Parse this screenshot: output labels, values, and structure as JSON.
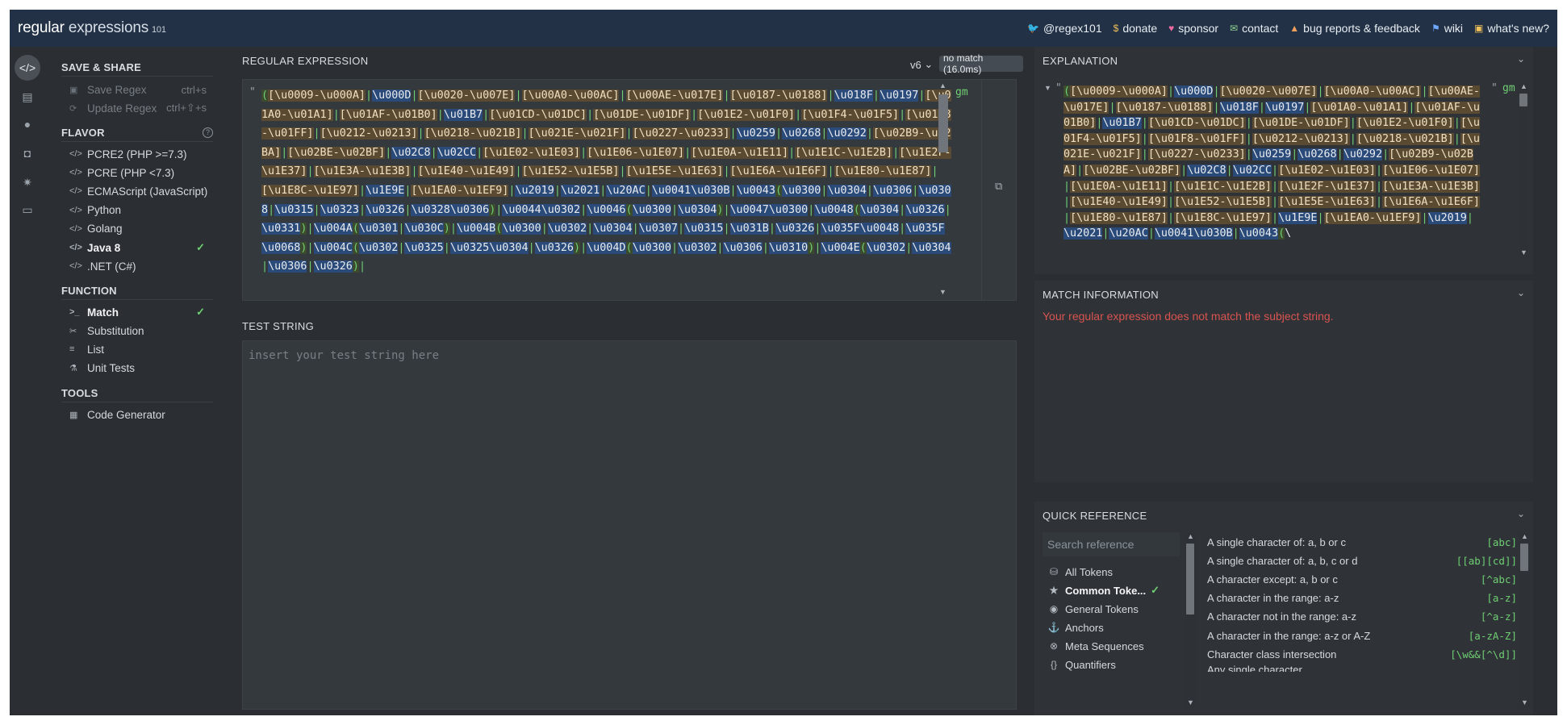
{
  "header": {
    "brand_main": "regular",
    "brand_rest": " expressions",
    "brand_ver": "101",
    "links": [
      {
        "icon": "twitter-icon",
        "glyph": "🐦",
        "label": "@regex101"
      },
      {
        "icon": "dollar-icon",
        "glyph": "$",
        "label": "donate"
      },
      {
        "icon": "heart-icon",
        "glyph": "♥",
        "label": "sponsor"
      },
      {
        "icon": "mail-icon",
        "glyph": "✉",
        "label": "contact"
      },
      {
        "icon": "warning-icon",
        "glyph": "▲",
        "label": "bug reports & feedback"
      },
      {
        "icon": "flag-icon",
        "glyph": "⚑",
        "label": "wiki"
      },
      {
        "icon": "gift-icon",
        "glyph": "▣",
        "label": "what's new?"
      }
    ],
    "link_colors": [
      "#6ea8fe",
      "#f0c05a",
      "#e86aa0",
      "#8fd18f",
      "#f0a05a",
      "#6ea8fe",
      "#f0c05a"
    ]
  },
  "sidebar": {
    "save_share_title": "SAVE & SHARE",
    "save_regex": "Save Regex",
    "save_shortcut": "ctrl+s",
    "update_regex": "Update Regex",
    "update_shortcut": "ctrl+⇧+s",
    "flavor_title": "FLAVOR",
    "flavors": [
      "PCRE2 (PHP >=7.3)",
      "PCRE (PHP <7.3)",
      "ECMAScript (JavaScript)",
      "Python",
      "Golang",
      "Java 8",
      ".NET (C#)"
    ],
    "selected_flavor": "Java 8",
    "function_title": "FUNCTION",
    "functions": [
      {
        "icon": "terminal-icon",
        "glyph": ">_",
        "label": "Match"
      },
      {
        "icon": "scissors-icon",
        "glyph": "✂",
        "label": "Substitution"
      },
      {
        "icon": "list-icon",
        "glyph": "≡",
        "label": "List"
      },
      {
        "icon": "flask-icon",
        "glyph": "⚗",
        "label": "Unit Tests"
      }
    ],
    "selected_function": "Match",
    "tools_title": "TOOLS",
    "code_generator": "Code Generator"
  },
  "regex": {
    "section_title": "REGULAR EXPRESSION",
    "version": "v6",
    "status": "no match (16.0ms)",
    "delimiter": "\"",
    "flags": "gm",
    "pattern": "([\\u0009-\\u000A]|\\u000D|[\\u0020-\\u007E]|[\\u00A0-\\u00AC]|[\\u00AE-\\u017E]|[\\u0187-\\u0188]|\\u018F|\\u0197|[\\u01A0-\\u01A1]|[\\u01AF-\\u01B0]|\\u01B7|[\\u01CD-\\u01DC]|[\\u01DE-\\u01DF]|[\\u01E2-\\u01F0]|[\\u01F4-\\u01F5]|[\\u01F8-\\u01FF]|[\\u0212-\\u0213]|[\\u0218-\\u021B]|[\\u021E-\\u021F]|[\\u0227-\\u0233]|\\u0259|\\u0268|\\u0292|[\\u02B9-\\u02BA]|[\\u02BE-\\u02BF]|\\u02C8|\\u02CC|[\\u1E02-\\u1E03]|[\\u1E06-\\u1E07]|[\\u1E0A-\\u1E11]|[\\u1E1C-\\u1E2B]|[\\u1E2F-\\u1E37]|[\\u1E3A-\\u1E3B]|[\\u1E40-\\u1E49]|[\\u1E52-\\u1E5B]|[\\u1E5E-\\u1E63]|[\\u1E6A-\\u1E6F]|[\\u1E80-\\u1E87]|[\\u1E8C-\\u1E97]|\\u1E9E|[\\u1EA0-\\u1EF9]|\\u2019|\\u2021|\\u20AC|\\u0041\\u030B|\\u0043(\\u0300|\\u0304|\\u0306|\\u0308|\\u0315|\\u0323|\\u0326|\\u0328\\u0306)|\\u0044\\u0302|\\u0046(\\u0300|\\u0304)|\\u0047\\u0300|\\u0048(\\u0304|\\u0326|\\u0331)|\\u004A(\\u0301|\\u030C)|\\u004B(\\u0300|\\u0302|\\u0304|\\u0307|\\u0315|\\u031B|\\u0326|\\u035F\\u0048|\\u035F\\u0068)|\\u004C(\\u0302|\\u0325|\\u0325\\u0304|\\u0326)|\\u004D(\\u0300|\\u0302|\\u0306|\\u0310)|\\u004E(\\u0302|\\u0304|\\u0306|\\u0326)|"
  },
  "test": {
    "section_title": "TEST STRING",
    "placeholder": "insert your test string here"
  },
  "explanation": {
    "title": "EXPLANATION",
    "quote": "\"",
    "flags": "gm",
    "text": "([\\u0009-\\u000A]|\\u000D|[\\u0020-\\u007E]|[\\u00A0-\\u00AC]|[\\u00AE-\\u017E]|[\\u0187-\\u0188]|\\u018F|\\u0197|[\\u01A0-\\u01A1]|[\\u01AF-\\u01B0]|\\u01B7|[\\u01CD-\\u01DC]|[\\u01DE-\\u01DF]|[\\u01E2-\\u01F0]|[\\u01F4-\\u01F5]|[\\u01F8-\\u01FF]|[\\u0212-\\u0213]|[\\u0218-\\u021B]|[\\u021E-\\u021F]|[\\u0227-\\u0233]|\\u0259|\\u0268|\\u0292|[\\u02B9-\\u02BA]|[\\u02BE-\\u02BF]|\\u02C8|\\u02CC|[\\u1E02-\\u1E03]|[\\u1E06-\\u1E07]|[\\u1E0A-\\u1E11]|[\\u1E1C-\\u1E2B]|[\\u1E2F-\\u1E37]|[\\u1E3A-\\u1E3B]|[\\u1E40-\\u1E49]|[\\u1E52-\\u1E5B]|[\\u1E5E-\\u1E63]|[\\u1E6A-\\u1E6F]|[\\u1E80-\\u1E87]|[\\u1E8C-\\u1E97]|\\u1E9E|[\\u1EA0-\\u1EF9]|\\u2019|\\u2021|\\u20AC|\\u0041\\u030B|\\u0043(\\"
  },
  "match_info": {
    "title": "MATCH INFORMATION",
    "message": "Your regular expression does not match the subject string."
  },
  "quick_ref": {
    "title": "QUICK REFERENCE",
    "search_placeholder": "Search reference",
    "categories": [
      {
        "icon": "stack-icon",
        "glyph": "⛁",
        "label": "All Tokens"
      },
      {
        "icon": "star-icon",
        "glyph": "★",
        "label": "Common Toke..."
      },
      {
        "icon": "circle-icon",
        "glyph": "◉",
        "label": "General Tokens"
      },
      {
        "icon": "anchor-icon",
        "glyph": "⚓",
        "label": "Anchors"
      },
      {
        "icon": "x-circle-icon",
        "glyph": "⊗",
        "label": "Meta Sequences"
      },
      {
        "icon": "braces-icon",
        "glyph": "{}",
        "label": "Quantifiers"
      }
    ],
    "selected_category": "Common Toke...",
    "entries": [
      {
        "desc": "A single character of: a, b or c",
        "code": "[abc]"
      },
      {
        "desc": "A single character of: a, b, c or d",
        "code": "[[ab][cd]]"
      },
      {
        "desc": "A character except: a, b or c",
        "code": "[^abc]"
      },
      {
        "desc": "A character in the range: a-z",
        "code": "[a-z]"
      },
      {
        "desc": "A character not in the range: a-z",
        "code": "[^a-z]"
      },
      {
        "desc": "A character in the range: a-z or A-Z",
        "code": "[a-zA-Z]"
      },
      {
        "desc": "Character class intersection",
        "code": "[\\w&&[^\\d]]"
      },
      {
        "desc": "Any single character",
        "code": "."
      }
    ]
  }
}
